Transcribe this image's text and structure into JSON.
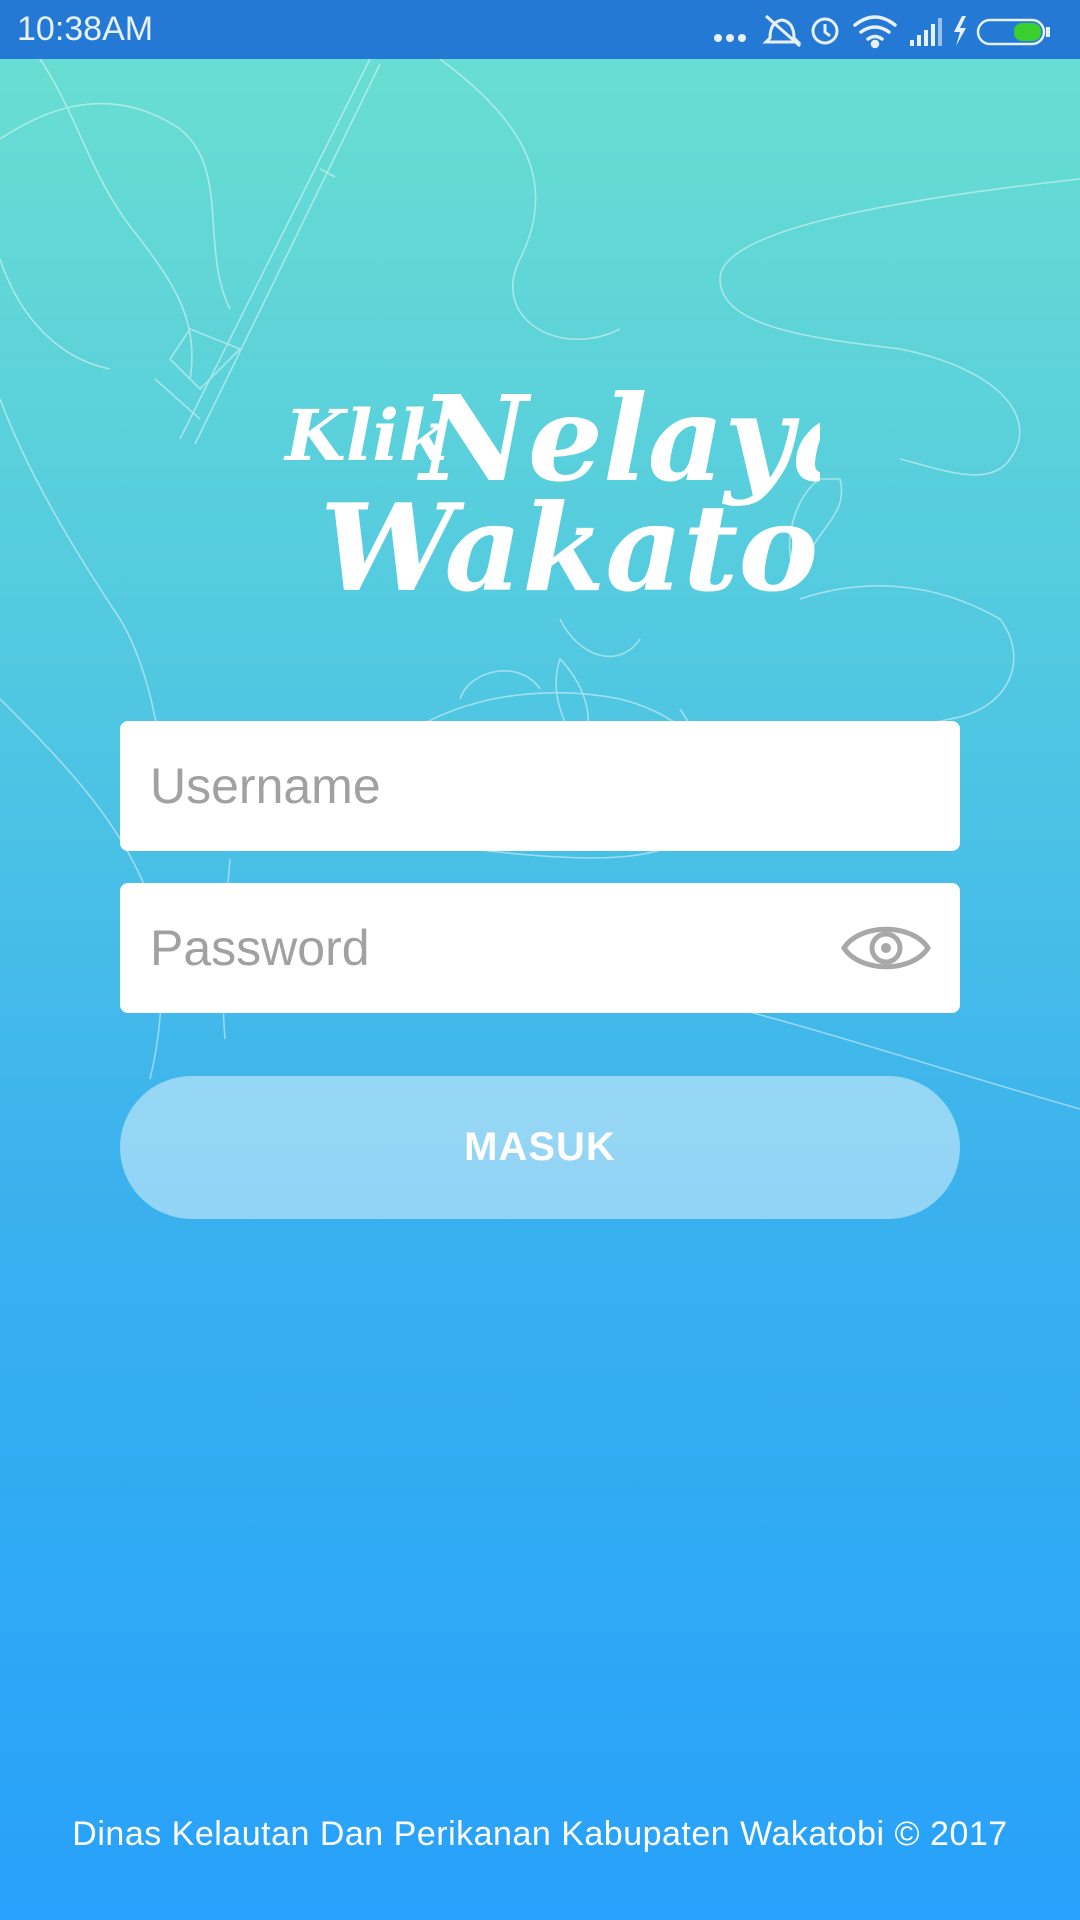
{
  "status_bar": {
    "time": "10:38AM",
    "icons": [
      "more-dots-icon",
      "notifications-muted-icon",
      "alarm-icon",
      "wifi-icon",
      "signal-icon",
      "charging-icon",
      "battery-icon"
    ],
    "battery_color": "#39d02f"
  },
  "logo": {
    "line1_small": "Klik",
    "line1_large": "Nelayan",
    "line2": "Wakatobi"
  },
  "login": {
    "username_placeholder": "Username",
    "username_value": "",
    "password_placeholder": "Password",
    "password_value": "",
    "submit_label": "MASUK"
  },
  "footer": {
    "text": "Dinas Kelautan Dan Perikanan Kabupaten Wakatobi © 2017"
  },
  "colors": {
    "status_bar": "#2479d4",
    "gradient_top": "#6be0d0",
    "gradient_bottom": "#27a1fb"
  }
}
